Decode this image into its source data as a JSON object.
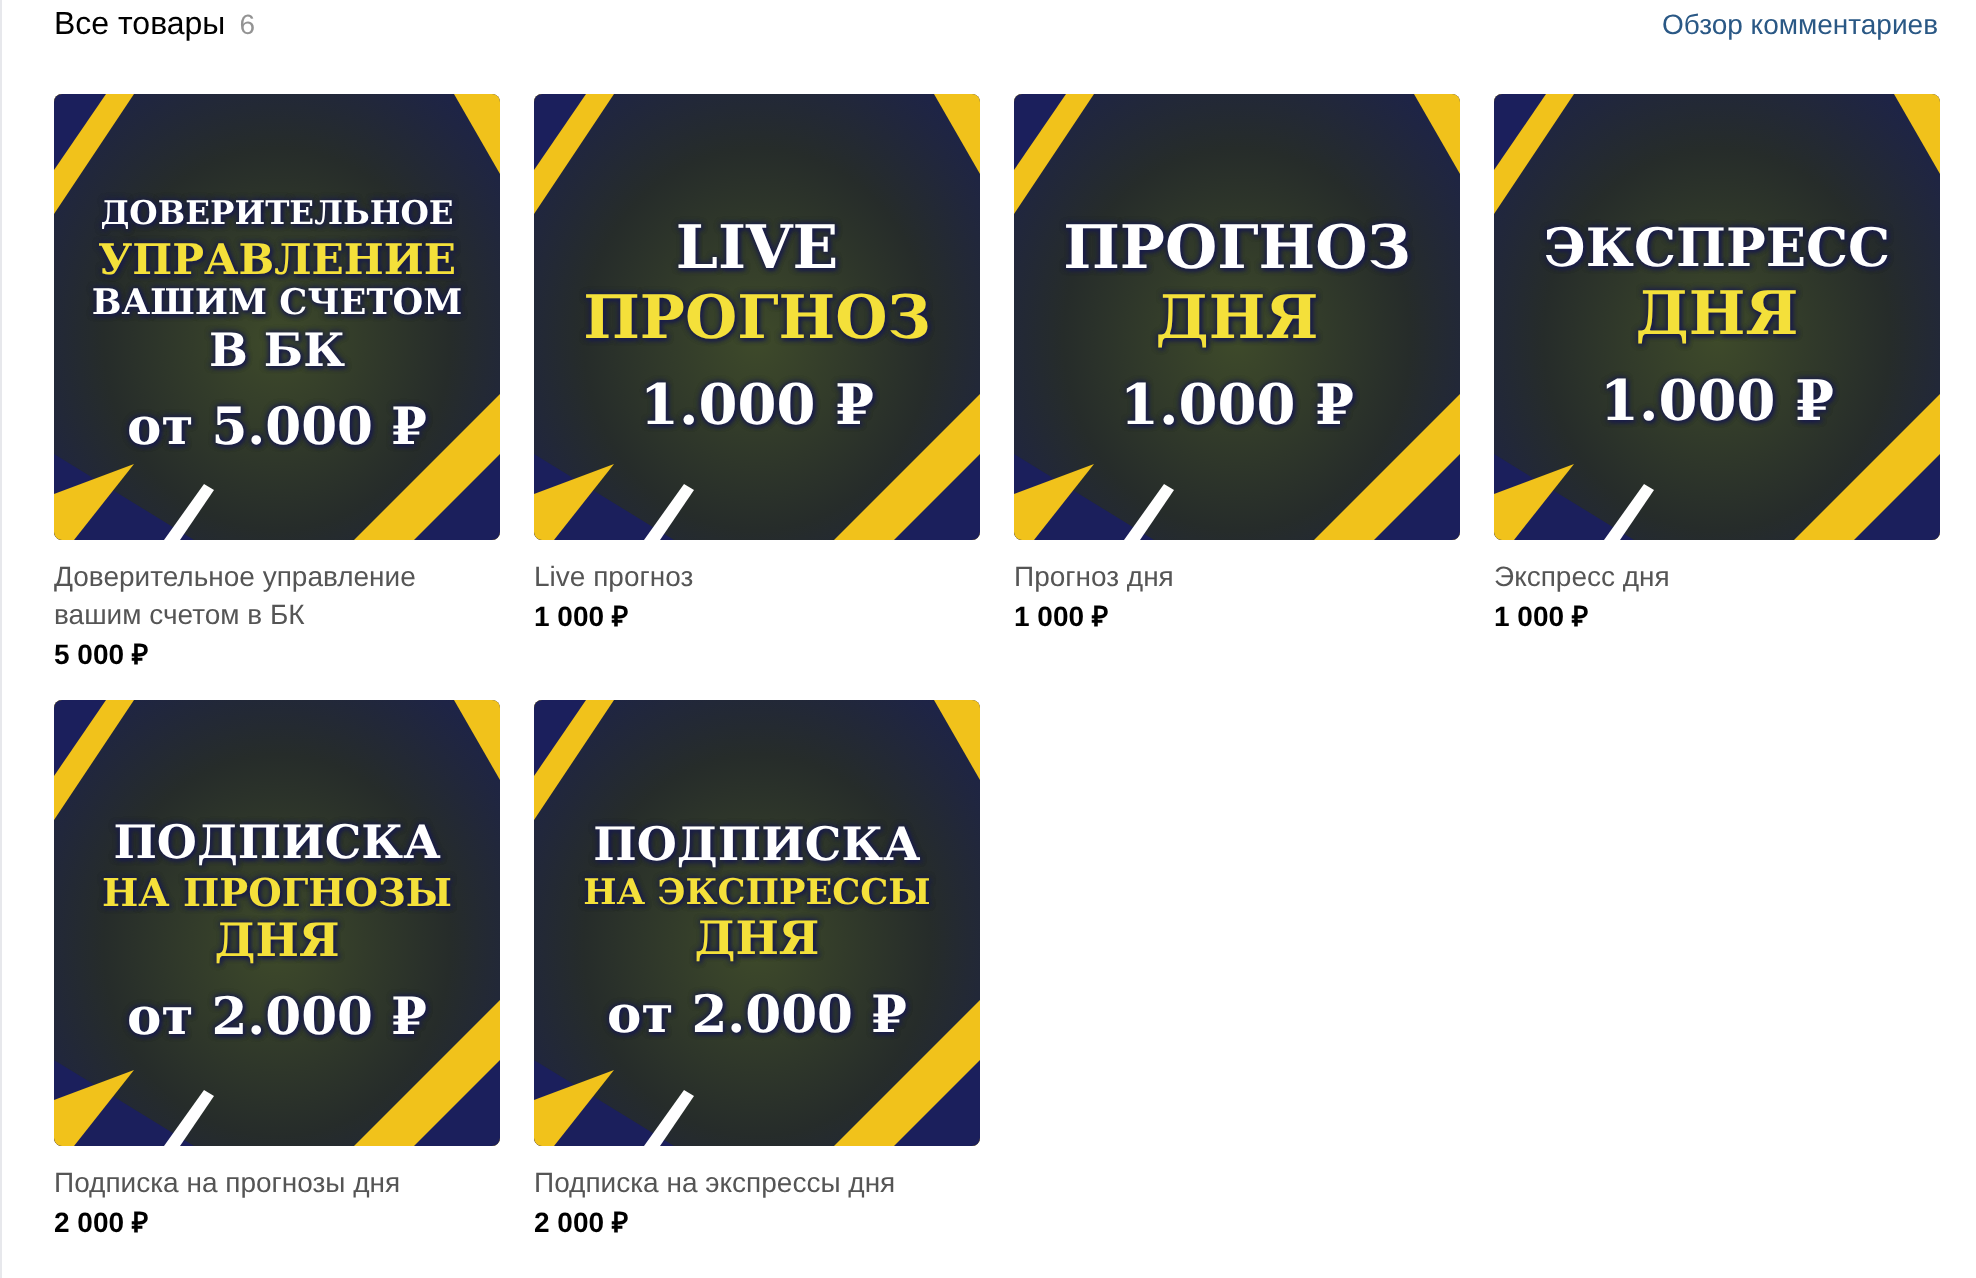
{
  "header": {
    "title": "Все товары",
    "count": "6",
    "link": "Обзор комментариев"
  },
  "products": [
    {
      "banner": [
        {
          "text": "ДОВЕРИТЕЛЬНОЕ",
          "kind": "caption",
          "accent": false
        },
        {
          "text": "УПРАВЛЕНИЕ",
          "kind": "caption",
          "accent": true
        },
        {
          "text": "ВАШИМ СЧЕТОМ",
          "kind": "caption",
          "accent": false
        },
        {
          "text": "В БК",
          "kind": "caption",
          "accent": false
        },
        {
          "text": "от 5.000 ₽",
          "kind": "price",
          "accent": false
        }
      ],
      "title": "Доверительное управление вашим счетом в БК",
      "price": "5 000 ₽"
    },
    {
      "banner": [
        {
          "text": "LIVE",
          "kind": "caption",
          "accent": false
        },
        {
          "text": "ПРОГНОЗ",
          "kind": "caption",
          "accent": true
        },
        {
          "text": "1.000 ₽",
          "kind": "price",
          "accent": false
        }
      ],
      "title": "Live прогноз",
      "price": "1 000 ₽"
    },
    {
      "banner": [
        {
          "text": "ПРОГНОЗ",
          "kind": "caption",
          "accent": false
        },
        {
          "text": "ДНЯ",
          "kind": "caption",
          "accent": true
        },
        {
          "text": "1.000 ₽",
          "kind": "price",
          "accent": false
        }
      ],
      "title": "Прогноз дня",
      "price": "1 000 ₽"
    },
    {
      "banner": [
        {
          "text": "ЭКСПРЕСС",
          "kind": "caption",
          "accent": false
        },
        {
          "text": "ДНЯ",
          "kind": "caption",
          "accent": true
        },
        {
          "text": "1.000 ₽",
          "kind": "price",
          "accent": false
        }
      ],
      "title": "Экспресс дня",
      "price": "1 000 ₽"
    },
    {
      "banner": [
        {
          "text": "ПОДПИСКА",
          "kind": "caption",
          "accent": false
        },
        {
          "text": "НА ПРОГНОЗЫ",
          "kind": "caption",
          "accent": true
        },
        {
          "text": "ДНЯ",
          "kind": "caption",
          "accent": true
        },
        {
          "text": "от 2.000 ₽",
          "kind": "price",
          "accent": false
        }
      ],
      "title": "Подписка на прогнозы дня",
      "price": "2 000 ₽"
    },
    {
      "banner": [
        {
          "text": "ПОДПИСКА",
          "kind": "caption",
          "accent": false
        },
        {
          "text": "НА ЭКСПРЕССЫ",
          "kind": "caption",
          "accent": true
        },
        {
          "text": "ДНЯ",
          "kind": "caption",
          "accent": true
        },
        {
          "text": "от 2.000 ₽",
          "kind": "price",
          "accent": false
        }
      ],
      "title": "Подписка на экспрессы дня",
      "price": "2 000 ₽"
    }
  ]
}
